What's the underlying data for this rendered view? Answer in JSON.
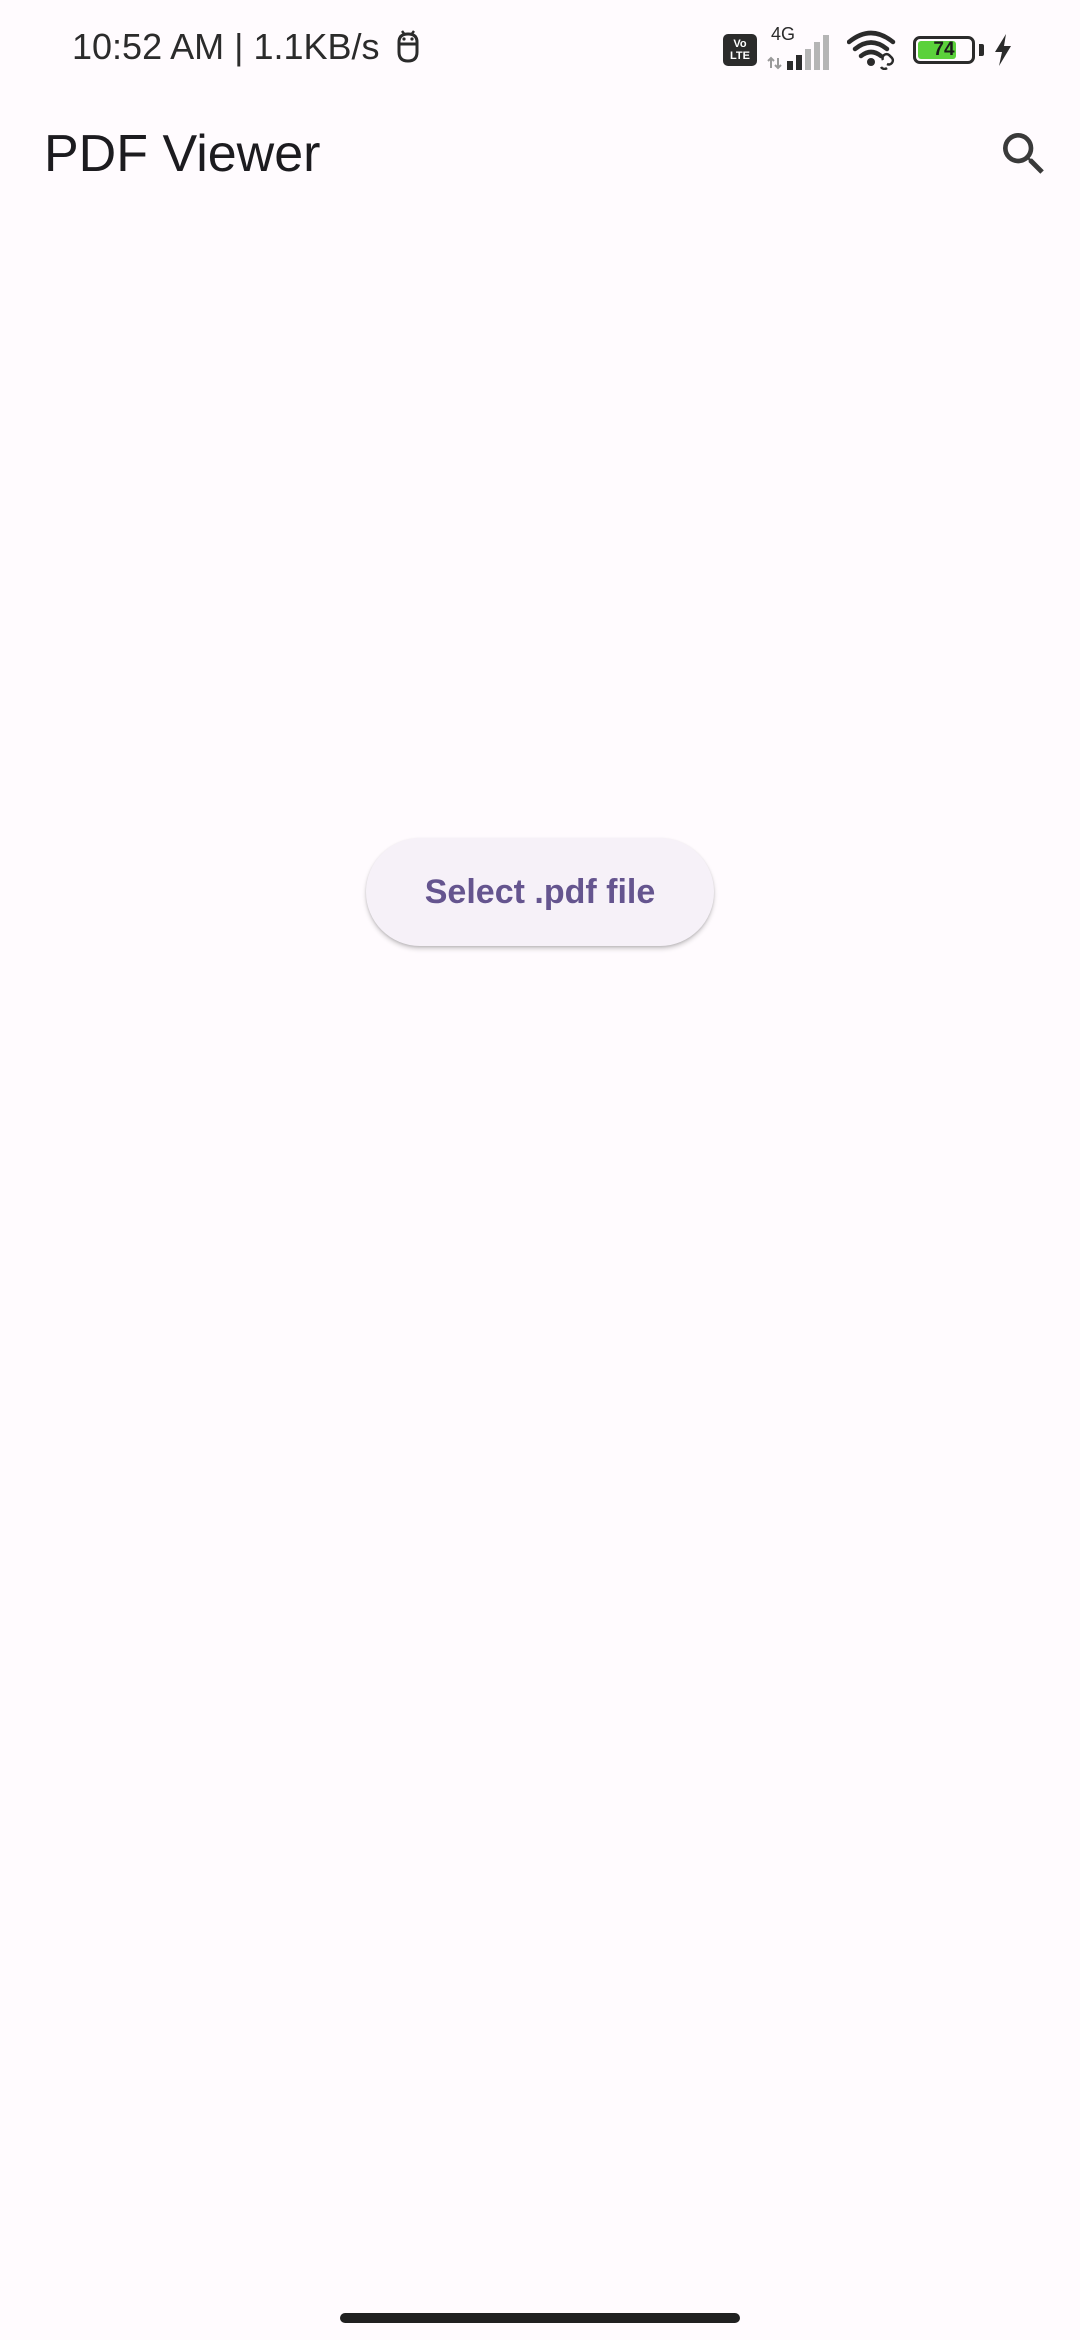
{
  "status_bar": {
    "time": "10:52 AM",
    "separator": "|",
    "network_speed": "1.1KB/s",
    "volte_line1": "Vo",
    "volte_line2": "LTE",
    "network_type": "4G",
    "battery_level": "74",
    "battery_fraction": 0.74,
    "battery_color": "#5bd13b",
    "icons": [
      "debug-icon",
      "volte-icon",
      "signal-icon",
      "wifi-icon",
      "battery-icon",
      "charging-icon"
    ]
  },
  "app_bar": {
    "title": "PDF Viewer",
    "search_icon": "search-icon"
  },
  "main": {
    "select_button_label": "Select .pdf file"
  },
  "colors": {
    "background": "#fffbfe",
    "button_background": "#f6f1f8",
    "button_text": "#65558f"
  }
}
